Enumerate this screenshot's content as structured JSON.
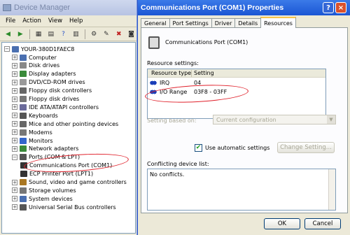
{
  "device_manager": {
    "title": "Device Manager",
    "menu": [
      "File",
      "Action",
      "View",
      "Help"
    ],
    "tree": {
      "root": "YOUR-380D1FAEC8",
      "items": [
        {
          "label": "Computer",
          "color": "#4a6fb0"
        },
        {
          "label": "Disk drives",
          "color": "#888888"
        },
        {
          "label": "Display adapters",
          "color": "#3a8a3a"
        },
        {
          "label": "DVD/CD-ROM drives",
          "color": "#999999"
        },
        {
          "label": "Floppy disk controllers",
          "color": "#666666"
        },
        {
          "label": "Floppy disk drives",
          "color": "#777777"
        },
        {
          "label": "IDE ATA/ATAPI controllers",
          "color": "#6a6a9a"
        },
        {
          "label": "Keyboards",
          "color": "#555555"
        },
        {
          "label": "Mice and other pointing devices",
          "color": "#666666"
        },
        {
          "label": "Modems",
          "color": "#777777"
        },
        {
          "label": "Monitors",
          "color": "#3366cc"
        },
        {
          "label": "Network adapters",
          "color": "#3a8a3a"
        },
        {
          "label": "Ports (COM & LPT)",
          "color": "#555555"
        },
        {
          "label": "Communications Port (COM1)",
          "color": "#333333"
        },
        {
          "label": "ECP Printer Port (LPT1)",
          "color": "#333333"
        },
        {
          "label": "Sound, video and game controllers",
          "color": "#aa7722"
        },
        {
          "label": "Storage volumes",
          "color": "#777777"
        },
        {
          "label": "System devices",
          "color": "#4a6fb0"
        },
        {
          "label": "Universal Serial Bus controllers",
          "color": "#555555"
        }
      ]
    }
  },
  "properties": {
    "title": "Communications Port (COM1) Properties",
    "help_btn": "?",
    "close_btn": "×",
    "tabs": [
      "General",
      "Port Settings",
      "Driver",
      "Details",
      "Resources"
    ],
    "device_name": "Communications Port (COM1)",
    "resource_settings_label": "Resource settings:",
    "columns": [
      "Resource type",
      "Setting"
    ],
    "rows": [
      {
        "type": "IRQ",
        "setting": "04"
      },
      {
        "type": "I/O Range",
        "setting": "03F8 - 03FF"
      }
    ],
    "setting_based_on_label": "Setting based on:",
    "setting_based_on_value": "Current configuration",
    "use_automatic_settings": "Use automatic settings",
    "change_setting": "Change Setting...",
    "conflict_label": "Conflicting device list:",
    "conflict_text": "No conflicts.",
    "ok": "OK",
    "cancel": "Cancel",
    "accent": "#e0202a"
  }
}
